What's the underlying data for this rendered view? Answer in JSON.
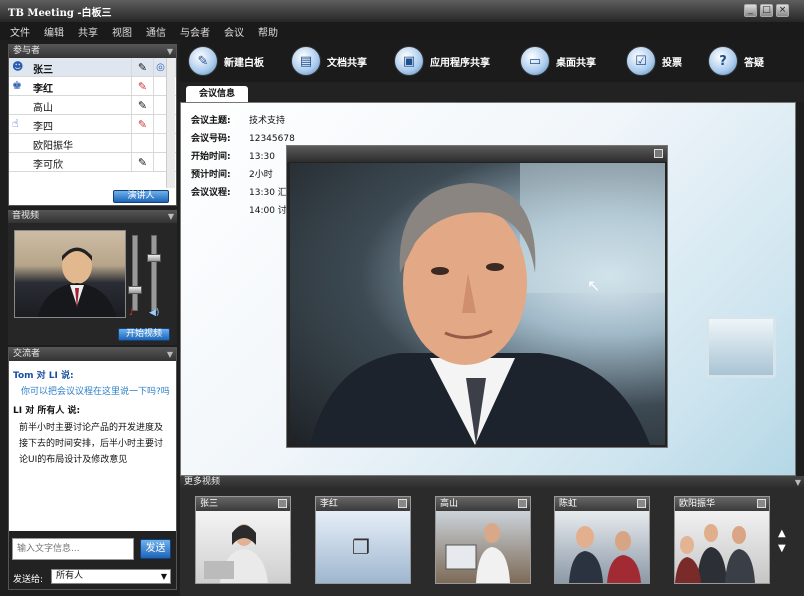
{
  "window": {
    "title": "TB Meeting -白板三"
  },
  "menu": [
    "文件",
    "编辑",
    "共享",
    "视图",
    "通信",
    "与会者",
    "会议",
    "帮助"
  ],
  "participants": {
    "title": "参与者",
    "items": [
      {
        "name": "张三",
        "icon": "presenter-icon",
        "c2": "✎",
        "c3": "◎",
        "selected": true
      },
      {
        "name": "李红",
        "icon": "host-icon",
        "c2": "✎",
        "c3": ""
      },
      {
        "name": "高山",
        "icon": "",
        "c2": "✎",
        "c3": ""
      },
      {
        "name": "李四",
        "icon": "hand-icon",
        "c2": "✎",
        "c3": ""
      },
      {
        "name": "欧阳振华",
        "icon": "",
        "c2": "",
        "c3": ""
      },
      {
        "name": "李可欣",
        "icon": "",
        "c2": "✎",
        "c3": ""
      }
    ],
    "presenter_button": "演讲人"
  },
  "av": {
    "title": "音视频",
    "start_video": "开始视频"
  },
  "chat": {
    "title": "交流者",
    "m1_from": "Tom",
    "m1_to": "对 LI 说:",
    "m1_text": "你可以把会议议程在这里说一下吗?吗",
    "m2_from": "LI",
    "m2_to": "对 所有人 说:",
    "m2_lines": [
      "前半小时主要讨论产品的开发进度及",
      "接下去的时间安排，后半小时主要讨",
      "论UI的布局设计及修改意见"
    ],
    "input_placeholder": "输入文字信息...",
    "send": "发送",
    "send_to_label": "发送给:",
    "send_to_value": "所有人"
  },
  "tools": [
    {
      "label": "新建白板",
      "icon": "whiteboard-icon",
      "glyph": "✎"
    },
    {
      "label": "文档共享",
      "icon": "document-icon",
      "glyph": "▤"
    },
    {
      "label": "应用程序共享",
      "icon": "app-share-icon",
      "glyph": "▣"
    },
    {
      "label": "桌面共享",
      "icon": "desktop-icon",
      "glyph": "▭"
    },
    {
      "label": "投票",
      "icon": "vote-icon",
      "glyph": "☑"
    },
    {
      "label": "答疑",
      "icon": "question-icon",
      "glyph": "?"
    }
  ],
  "tab": {
    "label": "会议信息"
  },
  "info": {
    "topic_label": "会议主题:",
    "topic": "技术支持",
    "id_label": "会议号码:",
    "id": "12345678",
    "start_label": "开始时间:",
    "start": "13:30",
    "duration_label": "预计时间:",
    "duration": "2小时",
    "agenda_label": "会议议程:",
    "agenda1": "13:30 汇报",
    "agenda2": "14:00 讨论"
  },
  "more": {
    "title": "更多视频",
    "thumbs": [
      "张三",
      "李红",
      "高山",
      "陈虹",
      "欧阳振华"
    ]
  },
  "colors": {
    "accent": "#1d64b8",
    "bg": "#1e1e1e"
  }
}
